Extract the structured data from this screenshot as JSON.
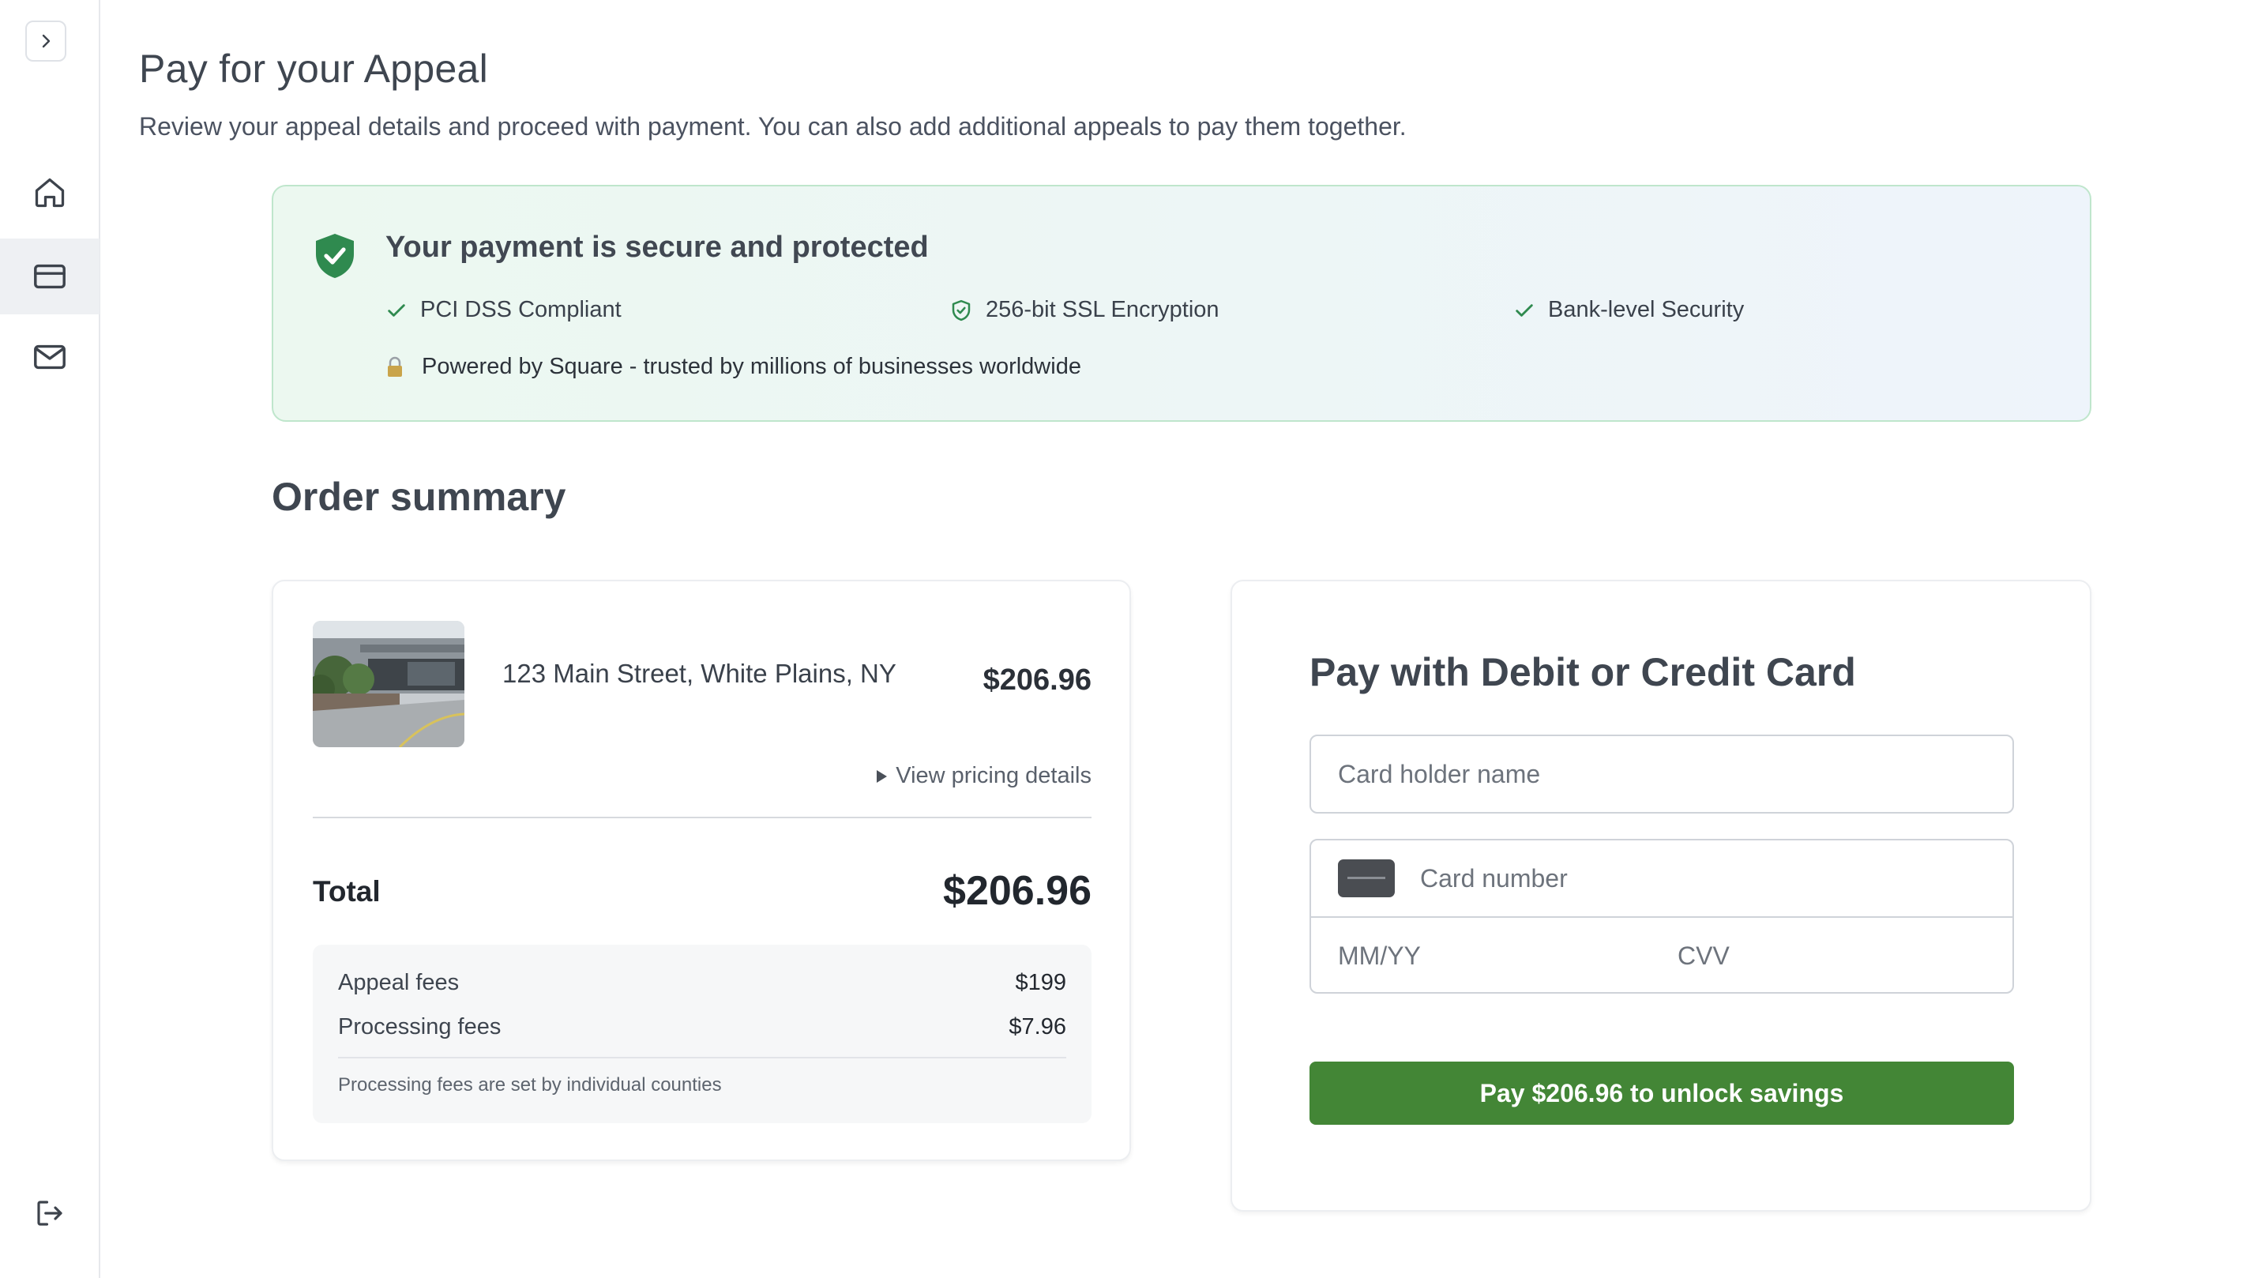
{
  "sidebar": {
    "items": [
      {
        "name": "home",
        "icon": "home-icon"
      },
      {
        "name": "billing",
        "icon": "credit-card-icon",
        "active": true
      },
      {
        "name": "messages",
        "icon": "mail-icon"
      }
    ],
    "logout_icon": "logout-icon",
    "collapse_icon": "chevron-right-icon"
  },
  "header": {
    "title": "Pay for your Appeal",
    "subtitle": "Review your appeal details and proceed with payment. You can also add additional appeals to pay them together."
  },
  "security": {
    "title": "Your payment is secure and protected",
    "features": [
      "PCI DSS Compliant",
      "256-bit SSL Encryption",
      "Bank-level Security"
    ],
    "powered_by": "Powered by Square - trusted by millions of businesses worldwide",
    "accent_color": "#2f8a4f"
  },
  "order": {
    "heading": "Order summary",
    "item": {
      "address": "123 Main Street, White Plains, NY",
      "price": "$206.96",
      "pricing_link": "View pricing details"
    },
    "total_label": "Total",
    "total_value": "$206.96",
    "fees": [
      {
        "label": "Appeal fees",
        "value": "$199"
      },
      {
        "label": "Processing fees",
        "value": "$7.96"
      }
    ],
    "fees_note": "Processing fees are set by individual counties"
  },
  "payment": {
    "title": "Pay with Debit or Credit Card",
    "cardholder_placeholder": "Card holder name",
    "card_number_placeholder": "Card number",
    "expiry_placeholder": "MM/YY",
    "cvv_placeholder": "CVV",
    "pay_button": "Pay $206.96 to unlock savings",
    "button_color": "#438636"
  }
}
